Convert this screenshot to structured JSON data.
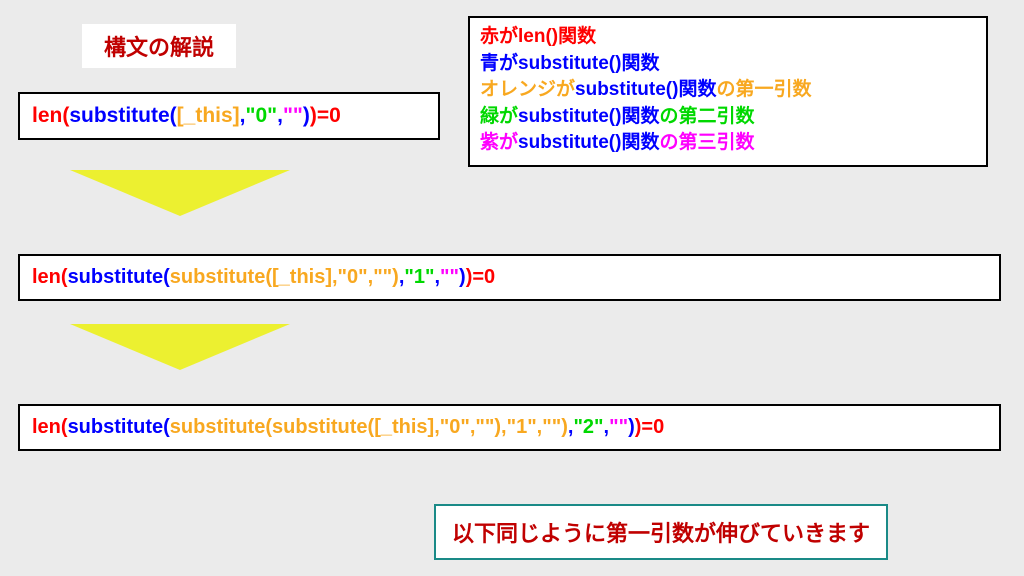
{
  "title": "構文の解説",
  "legend": {
    "l1_a": "赤が",
    "l1_b": "len()関数",
    "l2_a": "青が",
    "l2_b": "substitute()関数",
    "l3_a": "オレンジが",
    "l3_b": "substitute()関数",
    "l3_c": "の第一引数",
    "l4_a": "緑が",
    "l4_b": "substitute()関数",
    "l4_c": "の第二引数",
    "l5_a": "紫が",
    "l5_b": "substitute()関数",
    "l5_c": "の第三引数"
  },
  "f1": {
    "p1": "len(",
    "p2": "substitute(",
    "p3": "[_this]",
    "p4": ",",
    "p5": "\"0\"",
    "p6": ",",
    "p7": "\"\"",
    "p8": ")",
    "p9": ")=0"
  },
  "f2": {
    "p1": "len(",
    "p2": "substitute(",
    "p3": "substitute([_this],\"0\",\"\")",
    "p4": ",",
    "p5": "\"1\"",
    "p6": ",",
    "p7": "\"\"",
    "p8": ")",
    "p9": ")=0"
  },
  "f3": {
    "p1": "len(",
    "p2": "substitute(",
    "p3": "substitute(substitute([_this],\"0\",\"\"),\"1\",\"\")",
    "p4": ",",
    "p5": "\"2\"",
    "p6": ",",
    "p7": "\"\"",
    "p8": ")",
    "p9": ")=0"
  },
  "footer": "以下同じように第一引数が伸びていきます"
}
